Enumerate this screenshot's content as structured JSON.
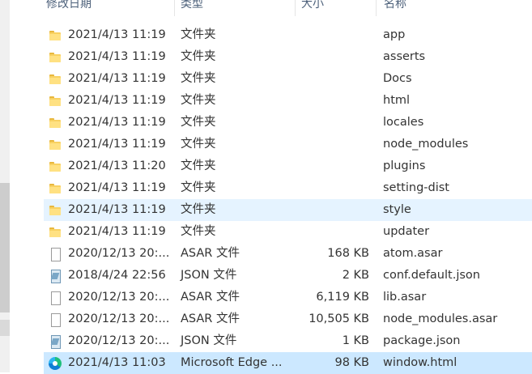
{
  "columns": {
    "date": "修改日期",
    "type": "类型",
    "size": "大小",
    "name": "名称"
  },
  "rows": [
    {
      "icon": "folder-icon",
      "date": "2021/4/13 11:19",
      "type": "文件夹",
      "size": "",
      "name": "app"
    },
    {
      "icon": "folder-icon",
      "date": "2021/4/13 11:19",
      "type": "文件夹",
      "size": "",
      "name": "asserts"
    },
    {
      "icon": "folder-icon",
      "date": "2021/4/13 11:19",
      "type": "文件夹",
      "size": "",
      "name": "Docs"
    },
    {
      "icon": "folder-icon",
      "date": "2021/4/13 11:19",
      "type": "文件夹",
      "size": "",
      "name": "html"
    },
    {
      "icon": "folder-icon",
      "date": "2021/4/13 11:19",
      "type": "文件夹",
      "size": "",
      "name": "locales"
    },
    {
      "icon": "folder-icon",
      "date": "2021/4/13 11:19",
      "type": "文件夹",
      "size": "",
      "name": "node_modules"
    },
    {
      "icon": "folder-icon",
      "date": "2021/4/13 11:20",
      "type": "文件夹",
      "size": "",
      "name": "plugins"
    },
    {
      "icon": "folder-icon",
      "date": "2021/4/13 11:19",
      "type": "文件夹",
      "size": "",
      "name": "setting-dist"
    },
    {
      "icon": "folder-icon",
      "date": "2021/4/13 11:19",
      "type": "文件夹",
      "size": "",
      "name": "style",
      "state": "hover"
    },
    {
      "icon": "folder-icon",
      "date": "2021/4/13 11:19",
      "type": "文件夹",
      "size": "",
      "name": "updater"
    },
    {
      "icon": "file-icon",
      "date": "2020/12/13 20:...",
      "type": "ASAR 文件",
      "size": "168 KB",
      "name": "atom.asar"
    },
    {
      "icon": "json-icon",
      "date": "2018/4/24 22:56",
      "type": "JSON 文件",
      "size": "2 KB",
      "name": "conf.default.json"
    },
    {
      "icon": "file-icon",
      "date": "2020/12/13 20:...",
      "type": "ASAR 文件",
      "size": "6,119 KB",
      "name": "lib.asar"
    },
    {
      "icon": "file-icon",
      "date": "2020/12/13 20:...",
      "type": "ASAR 文件",
      "size": "10,505 KB",
      "name": "node_modules.asar"
    },
    {
      "icon": "json-icon",
      "date": "2020/12/13 20:...",
      "type": "JSON 文件",
      "size": "1 KB",
      "name": "package.json"
    },
    {
      "icon": "edge-icon",
      "date": "2021/4/13 11:03",
      "type": "Microsoft Edge ...",
      "size": "98 KB",
      "name": "window.html",
      "state": "selected"
    }
  ]
}
